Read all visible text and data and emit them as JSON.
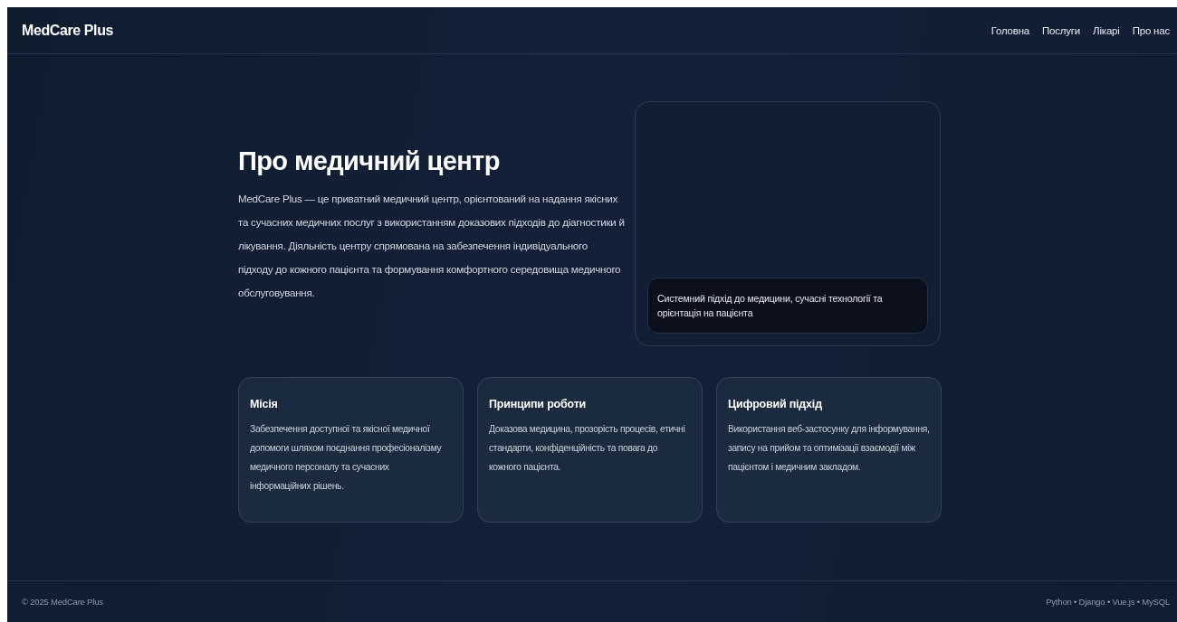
{
  "header": {
    "brand": "MedCare Plus",
    "nav": [
      {
        "label": "Головна"
      },
      {
        "label": "Послуги"
      },
      {
        "label": "Лікарі"
      },
      {
        "label": "Про нас"
      }
    ]
  },
  "hero": {
    "title": "Про медичний центр",
    "text": "MedCare Plus — це приватний медичний центр, орієнтований на надання якісних та сучасних медичних послуг з використанням доказових підходів до діагностики й лікування. Діяльність центру спрямована на забезпечення індивідуального підходу до кожного пацієнта та формування комфортного середовища медичного обслуговування.",
    "media_caption": "Системний підхід до медицини, сучасні технології та орієнтація на пацієнта"
  },
  "cards": [
    {
      "title": "Місія",
      "text": "Забезпечення доступної та якісної медичної допомоги шляхом поєднання професіоналізму медичного персоналу та сучасних інформаційних рішень."
    },
    {
      "title": "Принципи роботи",
      "text": "Доказова медицина, прозорість процесів, етичні стандарти, конфіденційність та повага до кожного пацієнта."
    },
    {
      "title": "Цифровий підхід",
      "text": "Використання веб-застосунку для інформування, запису на прийом та оптимізації взаємодії між пацієнтом і медичним закладом."
    }
  ],
  "footer": {
    "copyright": "© 2025 MedCare Plus",
    "stack": "Python • Django • Vue.js • MySQL"
  }
}
